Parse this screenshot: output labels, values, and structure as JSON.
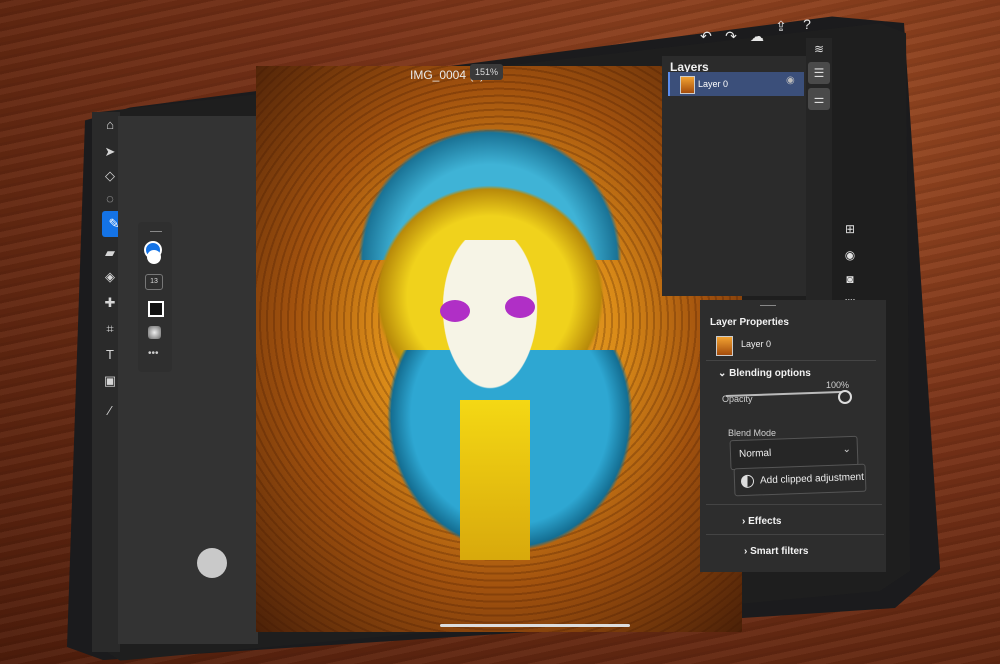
{
  "document": {
    "title": "IMG_0004 (1)",
    "zoom": "151%"
  },
  "layers_panel": {
    "title": "Layers",
    "layers": [
      {
        "name": "Layer 0",
        "visible": true
      }
    ]
  },
  "layer_properties": {
    "title": "Layer Properties",
    "layer_name": "Layer 0",
    "blending_options": {
      "title": "Blending options",
      "opacity_label": "Opacity",
      "opacity_value": "100%",
      "blend_mode_label": "Blend Mode",
      "blend_mode_value": "Normal"
    },
    "add_clipped_adjustment_label": "Add clipped adjustment",
    "effects_label": "Effects",
    "smart_filters_label": "Smart filters"
  },
  "brush_panel": {
    "size_value": "13"
  },
  "colors": {
    "accent": "#1473e6",
    "layer_selected": "#3b4f7a",
    "primary_swatch": "#1473e6"
  }
}
